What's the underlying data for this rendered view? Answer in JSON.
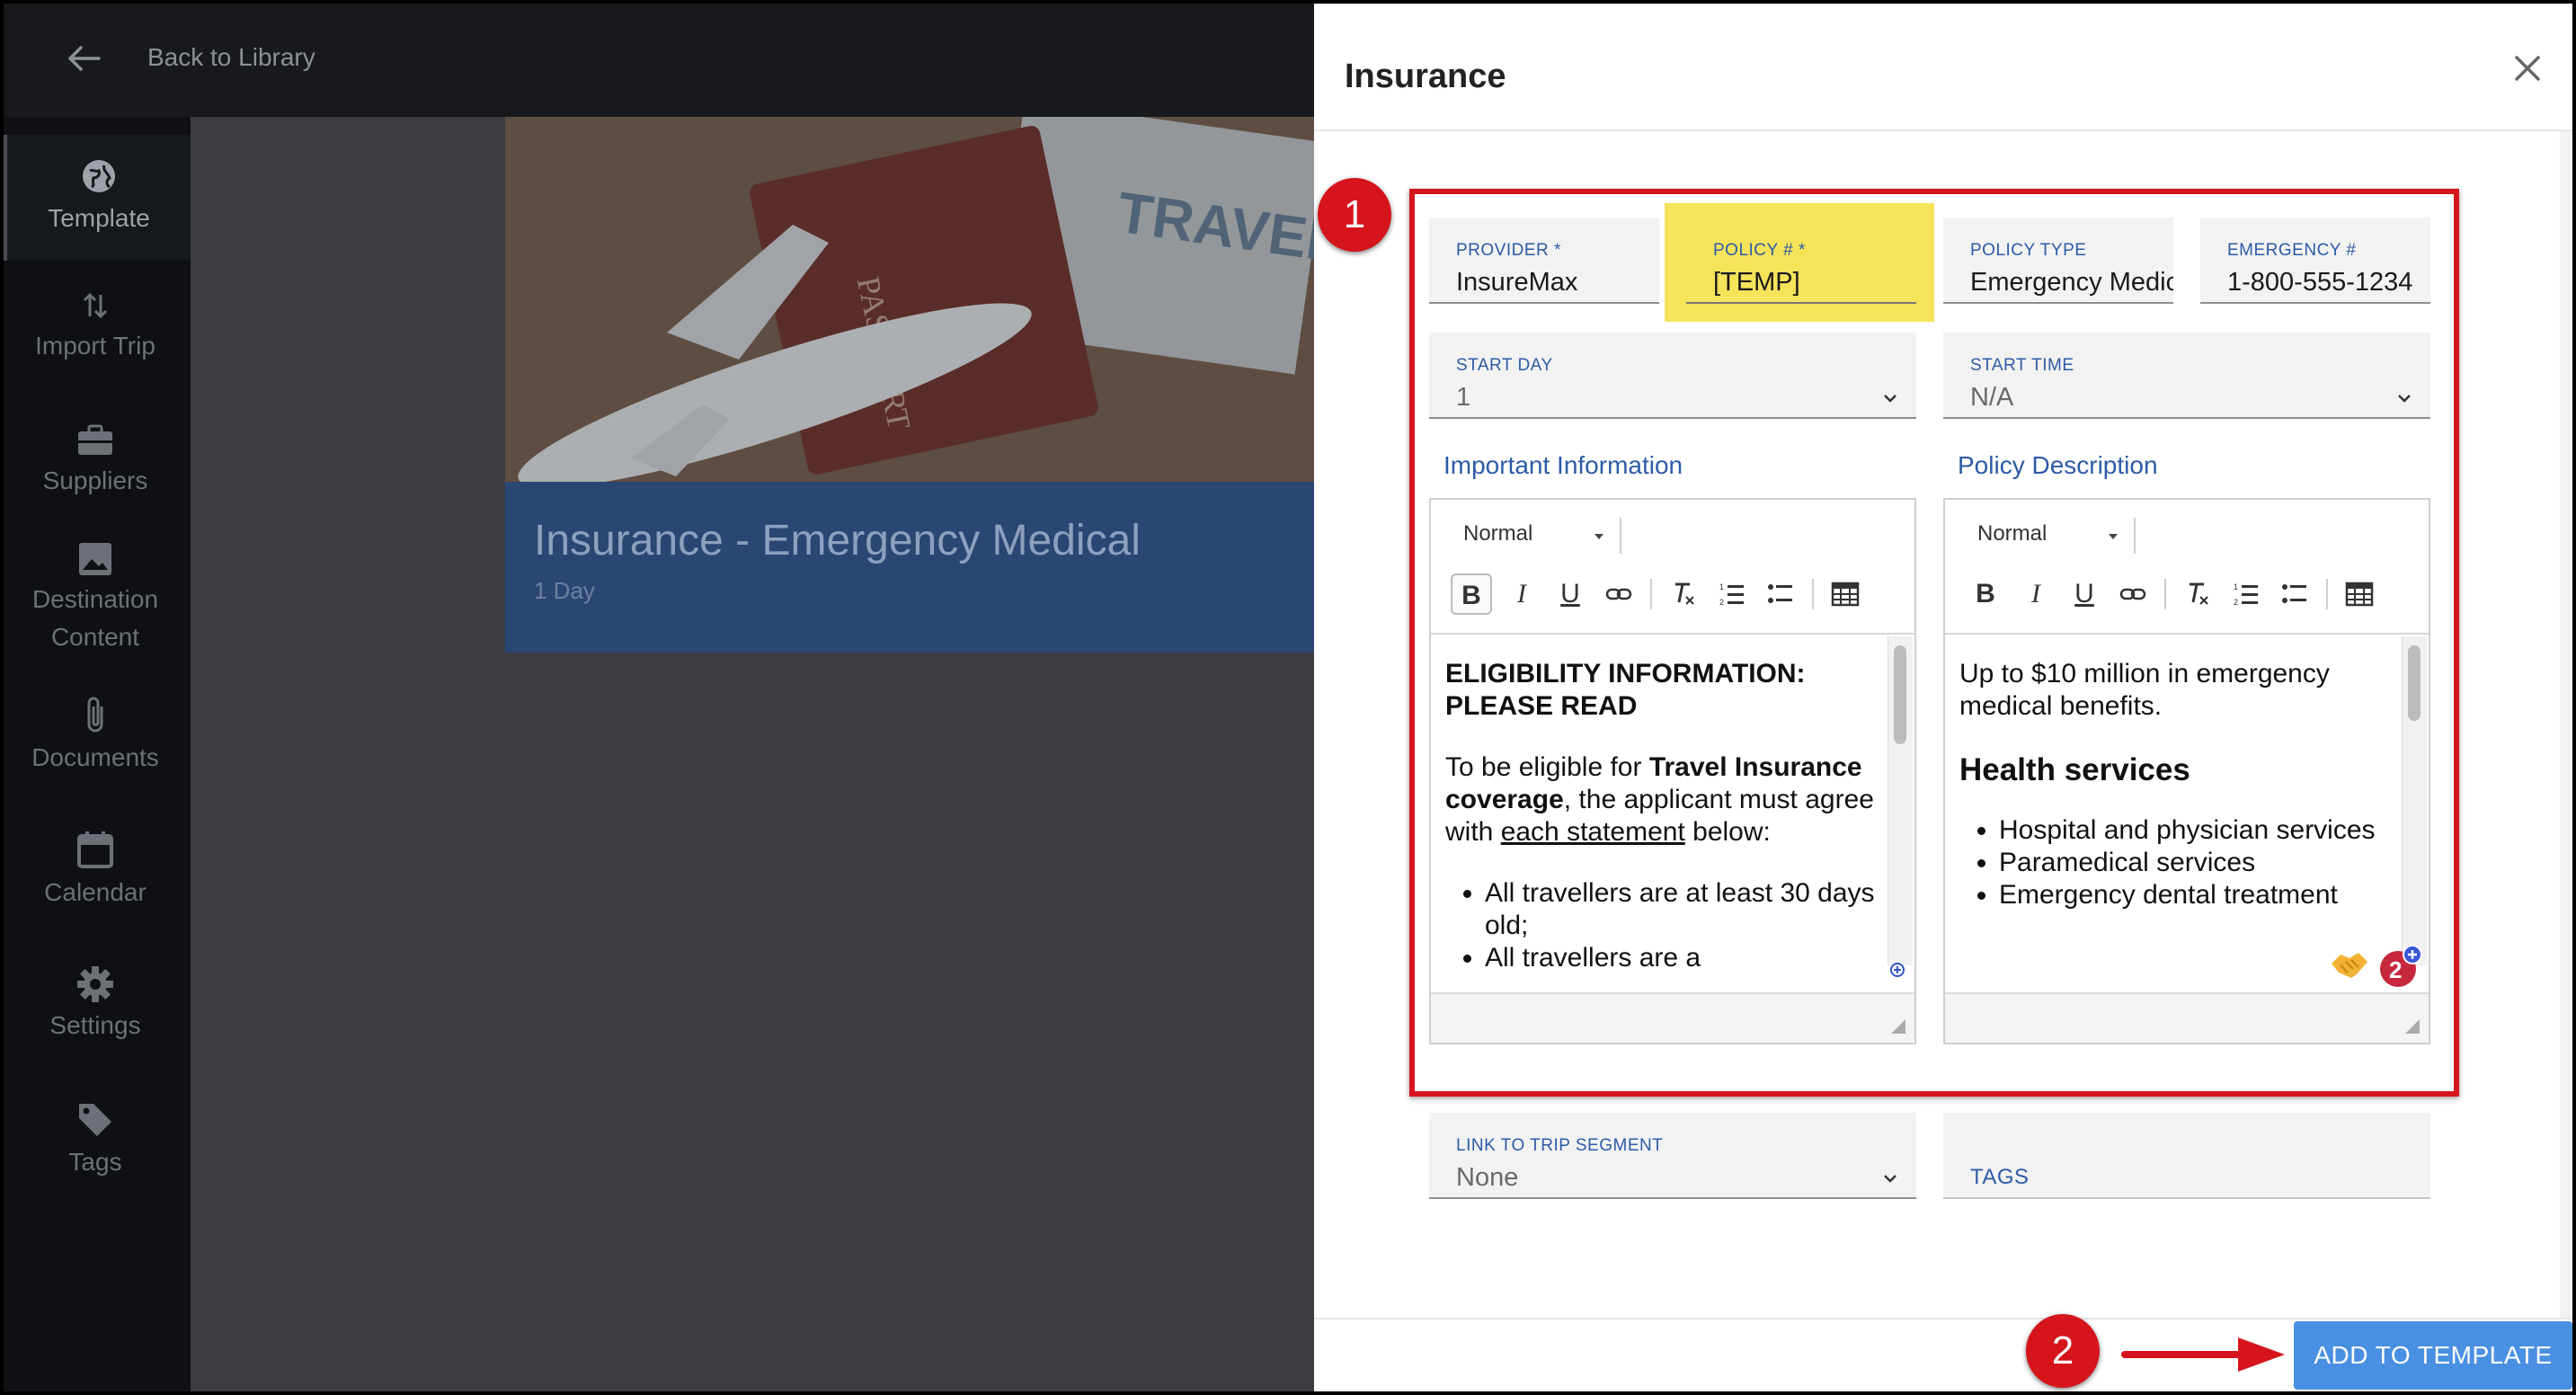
{
  "topbar": {
    "back_label": "Back to Library"
  },
  "sidebar": {
    "items": [
      {
        "label": "Template",
        "icon": "globe-icon"
      },
      {
        "label": "Import Trip",
        "icon": "import-arrows-icon"
      },
      {
        "label": "Suppliers",
        "icon": "briefcase-icon"
      },
      {
        "label": "Destination Content",
        "icon": "image-icon"
      },
      {
        "label": "Documents",
        "icon": "paperclip-icon"
      },
      {
        "label": "Calendar",
        "icon": "calendar-icon"
      },
      {
        "label": "Settings",
        "icon": "gear-icon"
      },
      {
        "label": "Tags",
        "icon": "tag-icon"
      }
    ]
  },
  "card": {
    "title": "Insurance - Emergency Medical",
    "subtitle": "1 Day",
    "image_text": "TRAVEL",
    "passport_text": "PASSPORT"
  },
  "modal": {
    "title": "Insurance",
    "fields": {
      "provider": {
        "label": "PROVIDER *",
        "value": "InsureMax"
      },
      "policy": {
        "label": "POLICY # *",
        "value": "[TEMP]"
      },
      "policy_type": {
        "label": "POLICY TYPE",
        "value": "Emergency Medical"
      },
      "emergency": {
        "label": "EMERGENCY #",
        "value": "1-800-555-1234"
      },
      "start_day": {
        "label": "START DAY",
        "value": "1"
      },
      "start_time": {
        "label": "START TIME",
        "value": "N/A"
      },
      "link_segment": {
        "label": "LINK TO TRIP SEGMENT",
        "value": "None"
      },
      "tags": {
        "label": "TAGS"
      }
    },
    "important_info": {
      "label": "Important Information",
      "format": "Normal",
      "heading": "ELIGIBILITY INFORMATION: PLEASE READ",
      "p_start": "To be eligible for ",
      "p_bold": "Travel Insurance coverage",
      "p_mid": ", the applicant must agree with ",
      "p_underline": "each statement",
      "p_end": " below:",
      "bullets": [
        "All travellers are at least 30 days old;",
        "All travellers are a"
      ]
    },
    "policy_desc": {
      "label": "Policy Description",
      "format": "Normal",
      "intro": "Up to $10 million in emergency medical benefits.",
      "heading": "Health services",
      "bullets": [
        "Hospital and physician services",
        "Paramedical services",
        "Emergency dental treatment"
      ],
      "grammarly_count": "2"
    },
    "add_button": "ADD TO TEMPLATE"
  },
  "annotations": {
    "badge1": "1",
    "badge2": "2"
  },
  "colors": {
    "annotation_red": "#d6141c",
    "accent_blue": "#2c5ba6",
    "button_blue": "#4a90e2",
    "highlight_yellow": "#f5e35a"
  }
}
